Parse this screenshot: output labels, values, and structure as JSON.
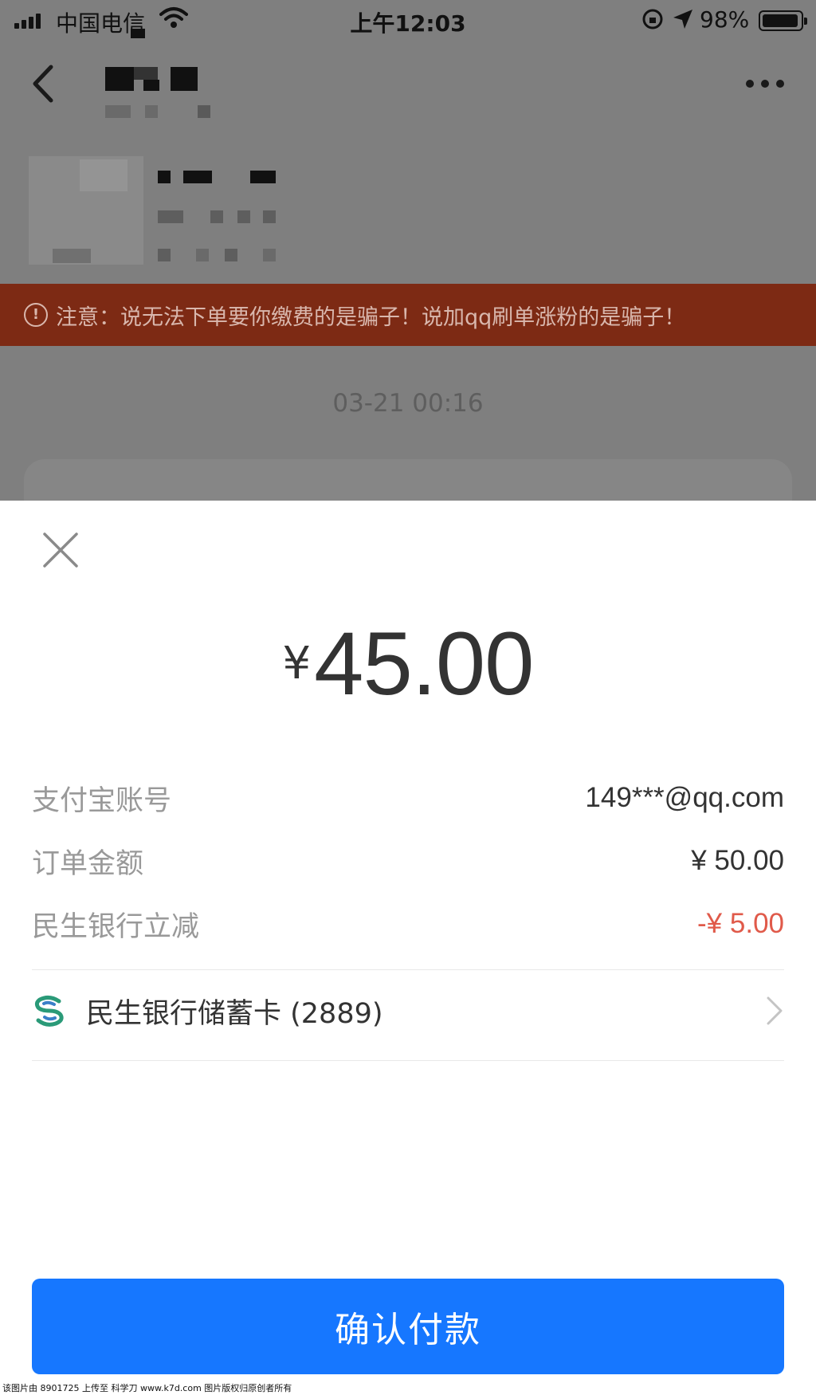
{
  "status_bar": {
    "carrier": "中国电信",
    "time": "上午12:03",
    "battery_percent": "98%"
  },
  "chat": {
    "warning_icon_glyph": "!",
    "warning_text": "注意：说无法下单要你缴费的是骗子！说加qq刷单涨粉的是骗子！",
    "timestamp": "03-21 00:16"
  },
  "payment": {
    "currency_symbol": "¥",
    "amount": "45.00",
    "details": [
      {
        "label": "支付宝账号",
        "value": "149***@qq.com",
        "style": "normal"
      },
      {
        "label": "订单金额",
        "value": "¥ 50.00",
        "style": "normal"
      },
      {
        "label": "民生银行立减",
        "value": "-¥ 5.00",
        "style": "discount"
      }
    ],
    "payment_method": "民生银行储蓄卡 (2889)",
    "confirm_label": "确认付款"
  },
  "footer_watermark": "该图片由 8901725 上传至 科学刀 www.k7d.com 图片版权归原创者所有",
  "colors": {
    "primary_button": "#1677ff",
    "discount_text": "#e05a4a",
    "warning_bar": "#7d2a14",
    "overlay": "#7f7f7f"
  }
}
